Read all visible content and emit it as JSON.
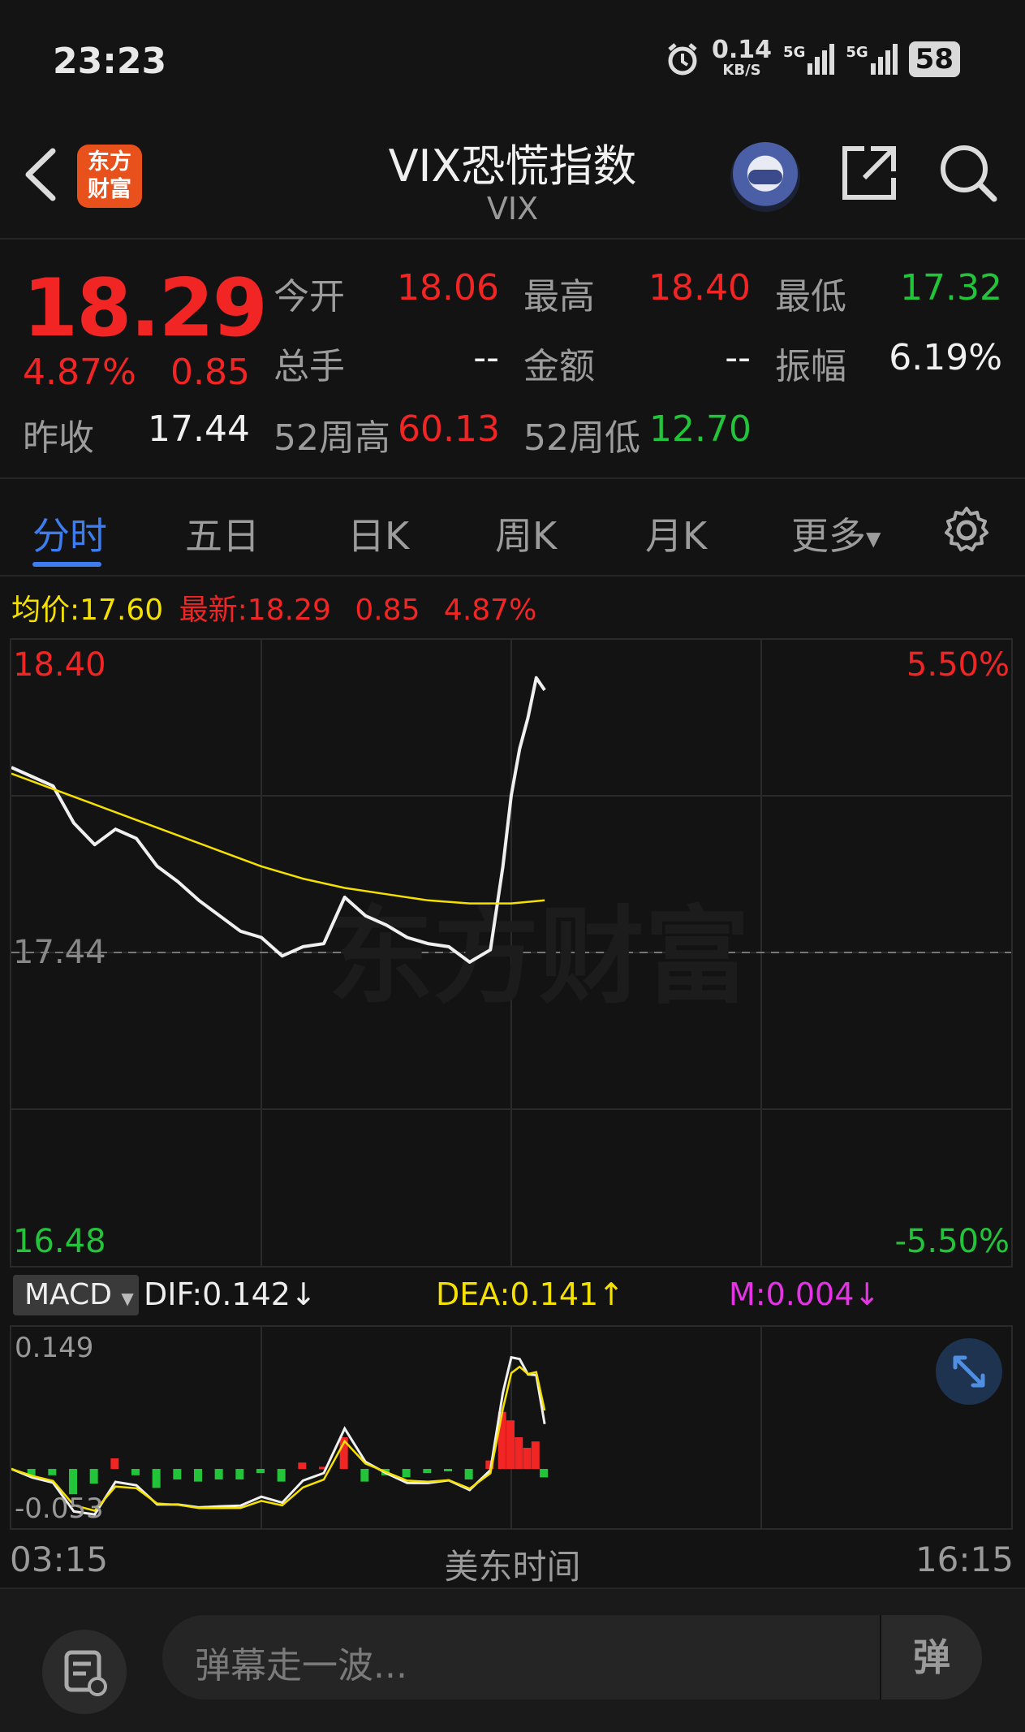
{
  "status_bar": {
    "time": "23:23",
    "net_speed": "0.14",
    "net_unit": "KB/S",
    "signal1": "5G",
    "signal2": "5G",
    "battery": "58",
    "icons": [
      "alarm-icon",
      "signal-icon",
      "battery-icon"
    ]
  },
  "header": {
    "logo_line1": "东方",
    "logo_line2": "财富",
    "title": "VIX恐慌指数",
    "subtitle": "VIX"
  },
  "quote": {
    "price": "18.29",
    "change_pct": "4.87%",
    "change": "0.85",
    "open_label": "今开",
    "open": "18.06",
    "high_label": "最高",
    "high": "18.40",
    "low_label": "最低",
    "low": "17.32",
    "volume_label": "总手",
    "volume": "--",
    "amount_label": "金额",
    "amount": "--",
    "amplitude_label": "振幅",
    "amplitude": "6.19%",
    "prev_close_label": "昨收",
    "prev_close": "17.44",
    "high52_label": "52周高",
    "high52": "60.13",
    "low52_label": "52周低",
    "low52": "12.70"
  },
  "tabs": [
    {
      "label": "分时"
    },
    {
      "label": "五日"
    },
    {
      "label": "日K"
    },
    {
      "label": "周K"
    },
    {
      "label": "月K"
    },
    {
      "label": "更多"
    }
  ],
  "info_line": {
    "avg_label": "均价:",
    "avg": "17.60",
    "latest_label": "最新:",
    "latest": "18.29",
    "change": "0.85",
    "pct": "4.87%"
  },
  "chart_axis": {
    "top_price": "18.40",
    "mid_price": "17.44",
    "bottom_price": "16.48",
    "top_pct": "5.50%",
    "bottom_pct": "-5.50%"
  },
  "macd": {
    "button": "MACD",
    "dif": "DIF:0.142↓",
    "dea": "DEA:0.141↑",
    "m": "M:0.004↓",
    "top": "0.149",
    "bottom": "-0.053"
  },
  "time_axis": {
    "start": "03:15",
    "mid": "美东时间",
    "end": "16:15"
  },
  "footer": {
    "placeholder": "弹幕走一波...",
    "send": "弹"
  },
  "colors": {
    "up": "#f22525",
    "down": "#22c43a",
    "avg_line": "#f5e100",
    "accent": "#3d7df0"
  },
  "chart_data": {
    "type": "line",
    "xlabel": "美东时间",
    "ylim": [
      16.48,
      18.4
    ],
    "prev_close": 17.44,
    "series": [
      {
        "name": "最新",
        "x": [
          0,
          5,
          10,
          15,
          20,
          25,
          30,
          35,
          40,
          45,
          50,
          55,
          60,
          65,
          70,
          75,
          80,
          85,
          90,
          95,
          100,
          105,
          110,
          115,
          118,
          120,
          122,
          124,
          126,
          128
        ],
        "values": [
          18.04,
          18.01,
          17.98,
          17.86,
          17.79,
          17.84,
          17.81,
          17.72,
          17.67,
          17.61,
          17.56,
          17.51,
          17.49,
          17.43,
          17.46,
          17.47,
          17.62,
          17.56,
          17.53,
          17.49,
          17.47,
          17.46,
          17.41,
          17.45,
          17.72,
          17.95,
          18.1,
          18.2,
          18.33,
          18.29
        ]
      },
      {
        "name": "均价",
        "x": [
          0,
          10,
          20,
          30,
          40,
          50,
          60,
          70,
          80,
          90,
          100,
          110,
          120,
          128
        ],
        "values": [
          18.02,
          17.97,
          17.92,
          17.87,
          17.82,
          17.77,
          17.72,
          17.68,
          17.65,
          17.63,
          17.61,
          17.6,
          17.6,
          17.61
        ]
      }
    ]
  }
}
